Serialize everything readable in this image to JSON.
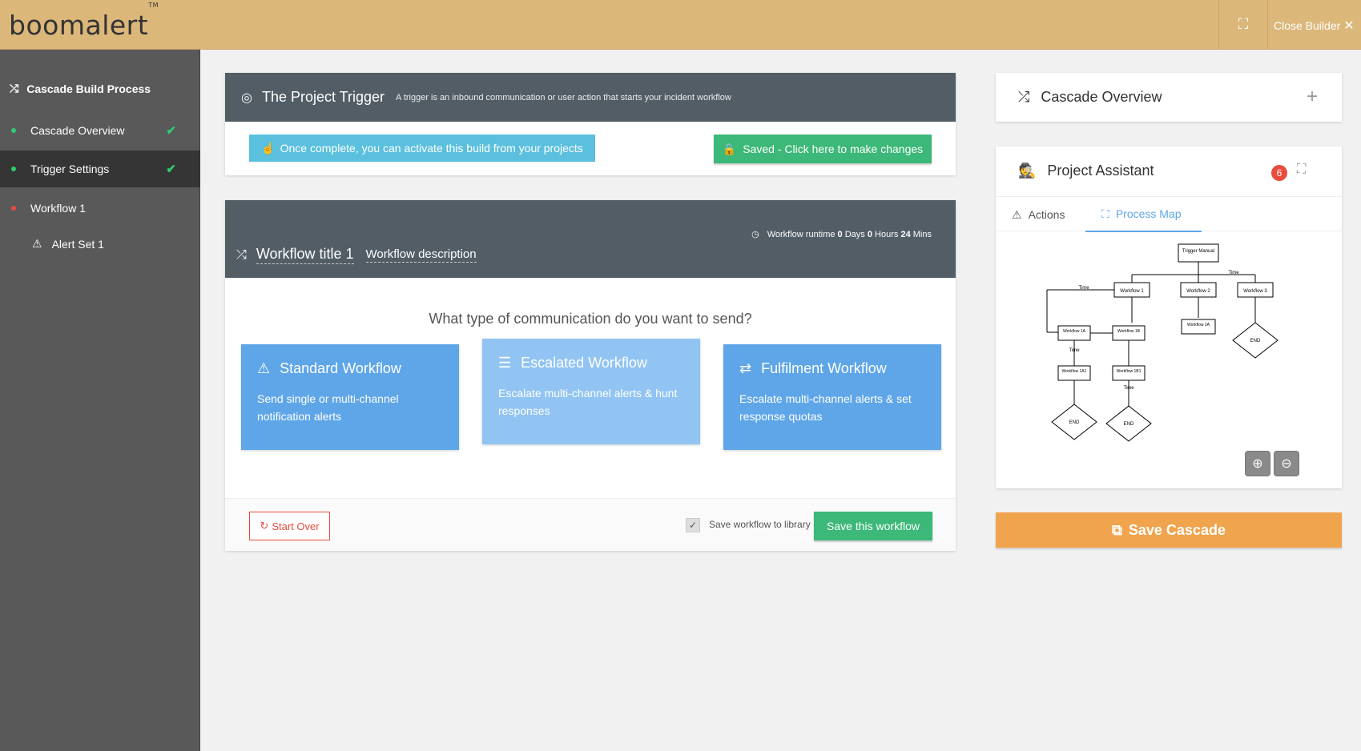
{
  "app": {
    "logo": "boomalert",
    "trademark": "TM",
    "close_builder": "Close Builder"
  },
  "sidebar": {
    "header": "Cascade Build Process",
    "items": [
      {
        "label": "Cascade Overview",
        "status": "complete"
      },
      {
        "label": "Trigger Settings",
        "status": "complete"
      },
      {
        "label": "Workflow 1",
        "status": "incomplete"
      }
    ],
    "sub_item": "Alert Set 1"
  },
  "trigger": {
    "title": "The Project Trigger",
    "description": "A trigger is an inbound communication or user action that starts your incident workflow",
    "info_button": "Once complete, you can activate this build from your projects",
    "saved_button": "Saved - Click here to make changes"
  },
  "workflow": {
    "runtime_label": "Workflow runtime",
    "days": "0",
    "days_label": "Days",
    "hours": "0",
    "hours_label": "Hours",
    "mins": "24",
    "mins_label": "Mins",
    "title": "Workflow title 1",
    "description": "Workflow description",
    "question": "What type of communication do you want to send?",
    "types": [
      {
        "title": "Standard Workflow",
        "desc": "Send single or multi-channel notification alerts"
      },
      {
        "title": "Escalated Workflow",
        "desc": "Escalate multi-channel alerts & hunt responses"
      },
      {
        "title": "Fulfilment Workflow",
        "desc": "Escalate multi-channel alerts & set response quotas"
      }
    ],
    "start_over": "Start Over",
    "save_library_label": "Save workflow to library",
    "save_library_checked": true,
    "save_button": "Save this workflow"
  },
  "overview": {
    "title": "Cascade Overview"
  },
  "assistant": {
    "title": "Project Assistant",
    "badge": "6",
    "tabs": [
      "Actions",
      "Process Map"
    ],
    "active_tab": "Process Map",
    "process_map": {
      "nodes": [
        "Trigger Manual",
        "Workflow 1",
        "Workflow 2",
        "Workflow 3",
        "Workflow 1A",
        "Workflow 1B",
        "Workflow 2A",
        "Workflow 1A1",
        "Workflow 1B1",
        "END"
      ],
      "edge_label": "Time"
    }
  },
  "save_cascade": "Save Cascade",
  "colors": {
    "topbar": "#dbb77a",
    "sidebar": "#595959",
    "panel_header": "#525d66",
    "success": "#3cb878",
    "info": "#5bc0de",
    "primary": "#5fa6e8",
    "warning": "#f0a44d",
    "danger": "#e74c3c"
  }
}
